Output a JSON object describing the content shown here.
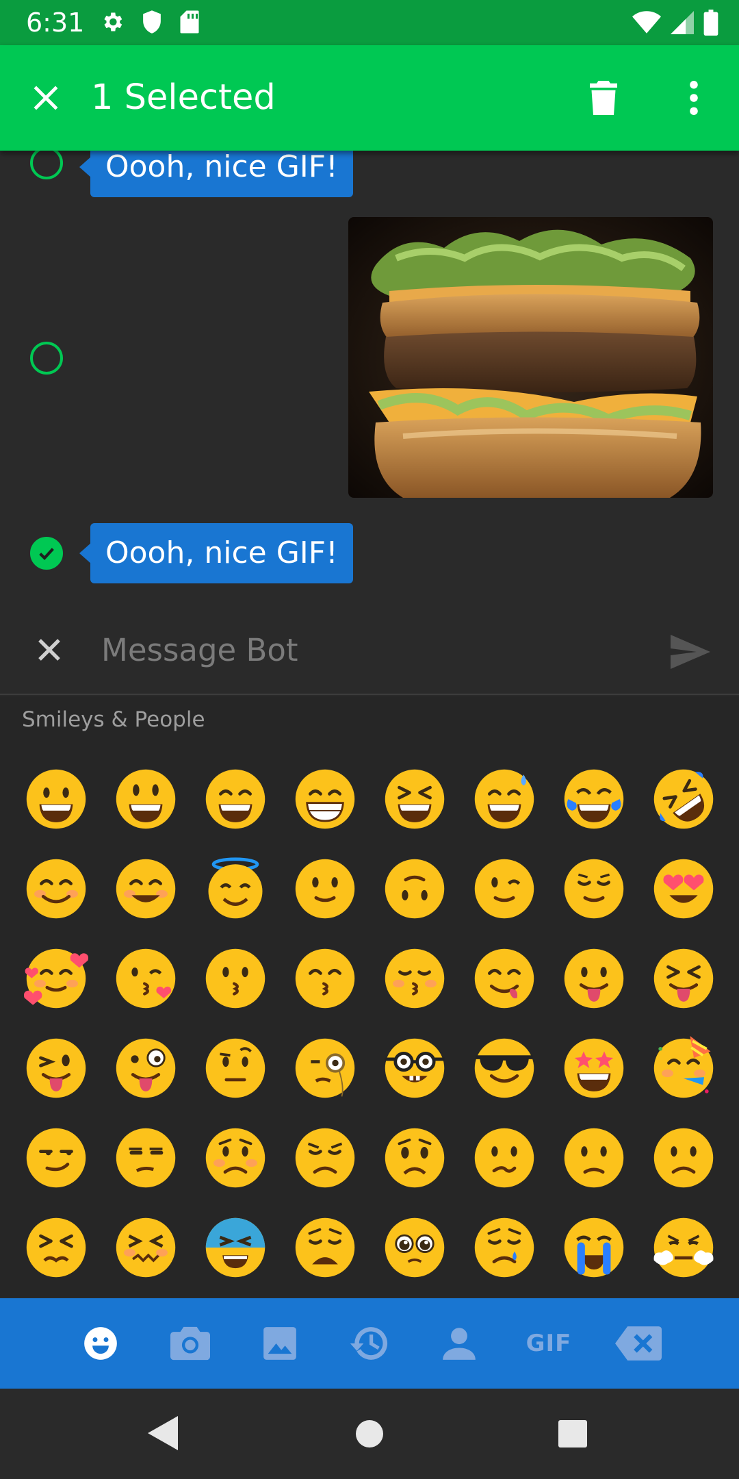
{
  "status_bar": {
    "time": "6:31",
    "left_icons": [
      "gear-icon",
      "shield-icon",
      "sd-card-icon"
    ],
    "right_icons": [
      "wifi-icon",
      "signal-icon",
      "battery-icon"
    ],
    "color": "#0a9c3f"
  },
  "app_bar": {
    "title": "1 Selected",
    "close_icon": "close-icon",
    "delete_icon": "trash-icon",
    "more_icon": "more-vert-icon",
    "color": "#00c853"
  },
  "messages": [
    {
      "type": "text",
      "text": "Oooh, nice GIF!",
      "selected": false
    },
    {
      "type": "gif",
      "description_icon": "burger-image",
      "selected": false
    },
    {
      "type": "text",
      "text": "Oooh, nice GIF!",
      "selected": true
    }
  ],
  "composer": {
    "placeholder": "Message Bot",
    "value": "",
    "clear_icon": "close-icon",
    "send_icon": "send-icon"
  },
  "emoji_panel": {
    "category": "Smileys & People",
    "emojis": [
      "grinning",
      "smiley",
      "smile",
      "grin",
      "laughing",
      "sweat-smile",
      "joy",
      "rofl",
      "blush",
      "happy-blush",
      "innocent",
      "slight-smile",
      "upside-down",
      "wink",
      "relieved",
      "heart-eyes",
      "smiling-hearts",
      "kissing-heart",
      "kissing",
      "kissing-smiling-eyes",
      "kissing-closed-eyes",
      "yum",
      "tongue",
      "squint-tongue",
      "wink-tongue",
      "zany",
      "raised-eyebrow",
      "monocle",
      "nerd",
      "sunglasses",
      "star-struck",
      "partying",
      "smirk",
      "unamused",
      "disappointed-worried",
      "pensive",
      "worried",
      "confused",
      "slight-frown",
      "frowning",
      "persevere",
      "confounded",
      "tired-cold",
      "weary",
      "pleading",
      "disappointed-relieved",
      "sob",
      "triumph"
    ]
  },
  "emoji_tabs": [
    {
      "icon": "smiley-icon",
      "active": true
    },
    {
      "icon": "camera-icon",
      "active": false
    },
    {
      "icon": "image-icon",
      "active": false
    },
    {
      "icon": "history-icon",
      "active": false
    },
    {
      "icon": "person-icon",
      "active": false
    },
    {
      "icon": "gif-icon",
      "label": "GIF",
      "active": false
    },
    {
      "icon": "backspace-icon",
      "active": false
    }
  ],
  "nav_bar": {
    "icons": [
      "back-icon",
      "home-icon",
      "recents-icon"
    ]
  },
  "colors": {
    "accent_green": "#00c853",
    "bubble_blue": "#1976d2",
    "background": "#2a2a2a",
    "emoji_tab_inactive": "#7fa9e0"
  }
}
